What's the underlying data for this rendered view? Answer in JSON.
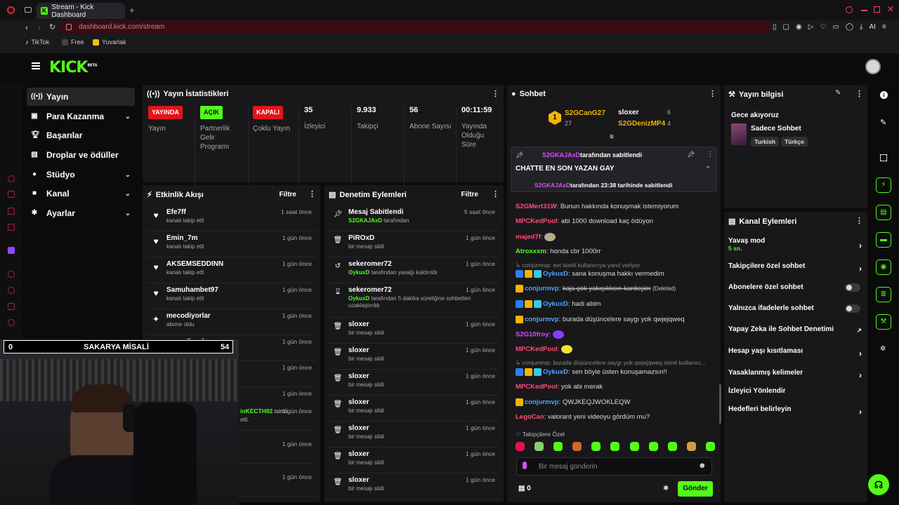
{
  "browser": {
    "tab_title": "Stream - Kick Dashboard",
    "url": "dashboard.kick.com/stream",
    "bookmarks": [
      "TikTok",
      "Free",
      "Yuvarlak"
    ]
  },
  "kick": {
    "logo": "KICK",
    "beta": "BETA"
  },
  "sidebar": {
    "items": [
      {
        "label": "Yayın",
        "icon": "broadcast-icon",
        "active": true
      },
      {
        "label": "Para Kazanma",
        "icon": "money-icon",
        "chevron": true
      },
      {
        "label": "Başarılar",
        "icon": "trophy-icon"
      },
      {
        "label": "Droplar ve ödüller",
        "icon": "gift-icon"
      },
      {
        "label": "Stüdyo",
        "icon": "studio-icon",
        "chevron": true
      },
      {
        "label": "Kanal",
        "icon": "user-icon",
        "chevron": true
      },
      {
        "label": "Ayarlar",
        "icon": "gear-icon",
        "chevron": true
      }
    ]
  },
  "stats": {
    "title": "Yayın İstatistikleri",
    "items": [
      {
        "badge": "YAYINDA",
        "label": "Yayın"
      },
      {
        "badge": "AÇIK",
        "label": "Partnerlik Gelir Programı"
      },
      {
        "badge": "KAPALI",
        "label": "Çoklu Yayın"
      },
      {
        "value": "35",
        "label": "İzleyici"
      },
      {
        "value": "9.933",
        "label": "Takipçi"
      },
      {
        "value": "56",
        "label": "Abone Sayısı"
      },
      {
        "value": "00:11:59",
        "label": "Yayında Olduğu Süre"
      }
    ]
  },
  "activity": {
    "title": "Etkinlik Akışı",
    "filter": "Filtre",
    "rows": [
      {
        "name": "Efe7ff",
        "sub": "kanalı takip etti",
        "time": "1 saat önce"
      },
      {
        "name": "Emin_7m",
        "sub": "kanalı takip etti",
        "time": "1 gün önce"
      },
      {
        "name": "AKSEMSEDDINN",
        "sub": "kanalı takip etti",
        "time": "1 gün önce"
      },
      {
        "name": "Samuhambet97",
        "sub": "kanalı takip etti",
        "time": "1 gün önce"
      },
      {
        "name": "mecodiyorlar",
        "sub": "abone oldu",
        "time": "1 gün önce"
      },
      {
        "name": "mecodiyorlar",
        "sub": "kanalı takip etti",
        "time": "1 gün önce"
      },
      {
        "time": "1 gün önce"
      },
      {
        "time": "1 gün önce"
      },
      {
        "name_partial": "inKECTH92",
        "name_suffix": " isimli",
        "sub_partial": "etti.",
        "time": "1 gün önce"
      },
      {
        "time": "1 gün önce"
      },
      {
        "time": "1 gün önce"
      }
    ]
  },
  "webcam_overlay": {
    "left": "0",
    "center": "SAKARYA MİSALİ",
    "right": "54"
  },
  "moderation": {
    "title": "Denetim Eylemleri",
    "filter": "Filtre",
    "rows": [
      {
        "name": "Mesaj Sabitlendi",
        "actor": "S2GKAJAxD",
        "sub": "tarafından",
        "time": "5 saat önce",
        "icon": "pin-icon"
      },
      {
        "name": "PiROxD",
        "sub": "bir mesajı sildi",
        "time": "1 gün önce",
        "icon": "trash-icon"
      },
      {
        "name": "sekeromer72",
        "actor": "OykuxD",
        "sub": "tarafından yasağı kaldırıldı",
        "time": "1 gün önce",
        "icon": "undo-icon"
      },
      {
        "name": "sekeromer72",
        "actor": "OykuxD",
        "sub": "tarafından 5 dakika süreliğine sohbetten uzaklaştırıldı",
        "time": "1 gün önce",
        "icon": "hourglass-icon"
      },
      {
        "name": "sloxer",
        "sub": "bir mesajı sildi",
        "time": "1 gün önce",
        "icon": "trash-icon"
      },
      {
        "name": "sloxer",
        "sub": "bir mesajı sildi",
        "time": "1 gün önce",
        "icon": "trash-icon"
      },
      {
        "name": "sloxer",
        "sub": "bir mesajı sildi",
        "time": "1 gün önce",
        "icon": "trash-icon"
      },
      {
        "name": "sloxer",
        "sub": "bir mesajı sildi",
        "time": "1 gün önce",
        "icon": "trash-icon"
      },
      {
        "name": "sloxer",
        "sub": "bir mesajı sildi",
        "time": "1 gün önce",
        "icon": "trash-icon"
      },
      {
        "name": "sloxer",
        "sub": "bir mesajı sildi",
        "time": "1 gün önce",
        "icon": "trash-icon"
      },
      {
        "name": "sloxer",
        "sub": "bir mesajı sildi",
        "time": "1 gün önce",
        "icon": "trash-icon"
      }
    ]
  },
  "chat": {
    "title": "Sohbet",
    "leaderboard": [
      {
        "rank": "1",
        "name": "S2GCanG27",
        "count": "27"
      },
      {
        "name": "sloxer",
        "count": "6"
      },
      {
        "name": "S2GDenizMP4",
        "count": "4"
      }
    ],
    "pinned": {
      "by_user": "S2GKAJAxD",
      "by_text": "tarafından sabitlendi",
      "message": "CHATTE EN SON YAZAN GAY",
      "footer_user": "S2GKAJAxD",
      "footer_text": "tarafından 23:38 tarihinde sabitlendi"
    },
    "messages": [
      {
        "user": "S2GMert31W",
        "text": "Bunun hakkında konuşmak istemiyorum",
        "cls": "u-red"
      },
      {
        "user": "MPCKedPool",
        "text": "abi 1000 download kaç ödüyon",
        "cls": "u-red"
      },
      {
        "user": "majed7f",
        "text": "",
        "cls": "u-red"
      },
      {
        "user": "Atroxxxm",
        "text": "honda cbr 1000rr",
        "cls": "u-green"
      },
      {
        "reply": "conjurmvp: evt isimli kullanıcıya yanıt veriyor"
      },
      {
        "user": "OykuxD",
        "text": "sana konuşma hakkı vermedim",
        "cls": "u-blue"
      },
      {
        "user": "conjurmvp",
        "text": "kaja çok yakışıklısın kardeşim",
        "deleted": "(Deleted)",
        "cls": "u-blue"
      },
      {
        "user": "OykuxD",
        "text": "hadi abim",
        "cls": "u-blue"
      },
      {
        "user": "conjurmvp",
        "text": "burada düşüncelere saygı yok qwjejqweq",
        "cls": "u-blue"
      },
      {
        "user": "S2G10froy",
        "text": "",
        "cls": "u-pink"
      },
      {
        "user": "MPCKedPool",
        "text": "",
        "cls": "u-red"
      },
      {
        "reply": "conjurmvp: burada düşüncelere saygı yok qwjejqweq isimli kullanıcı..."
      },
      {
        "user": "OykuxD",
        "text": "sen böyle üsten konuşamazsın!!",
        "cls": "u-blue"
      },
      {
        "user": "MPCKedPool",
        "text": "yok abi merak",
        "cls": "u-red"
      },
      {
        "user": "conjurmvp",
        "text": "QWJKEQJWOKLEQW",
        "cls": "u-blue"
      },
      {
        "user": "LegoCan",
        "text": "valorant yeni videoyu gördüm mu?",
        "cls": "u-red"
      }
    ],
    "followers_only": "Takipçilere Özel",
    "input_placeholder": "Bir mesaj gönderin",
    "points": "0",
    "send": "Gönder"
  },
  "stream_info": {
    "title": "Yayın bilgisi",
    "stream_title": "Gece akıyoruz",
    "category": "Sadece Sohbet",
    "tags": [
      "Turkish",
      "Türkçe"
    ]
  },
  "channel_actions": {
    "title": "Kanal Eylemleri",
    "items": [
      {
        "label": "Yavaş mod",
        "sub": "5 sn.",
        "type": "arrow"
      },
      {
        "label": "Takipçilere özel sohbet",
        "type": "arrow"
      },
      {
        "label": "Abonelere özel sohbet",
        "type": "toggle"
      },
      {
        "label": "Yalnızca ifadelerle sohbet",
        "type": "toggle"
      },
      {
        "label": "Yapay Zeka ile Sohbet Denetimi",
        "type": "external"
      },
      {
        "label": "Hesap yaşı kısıtlaması",
        "type": "arrow"
      },
      {
        "label": "Yasaklanmış kelimeler",
        "type": "arrow"
      },
      {
        "label": "İzleyici Yönlendir",
        "type": "none"
      },
      {
        "label": "Hedefleri belirleyin",
        "type": "arrow"
      }
    ]
  },
  "colors": {
    "accent": "#53fc18",
    "live": "#e3141a",
    "panel": "#18181b",
    "bg": "#0b0b0c"
  }
}
